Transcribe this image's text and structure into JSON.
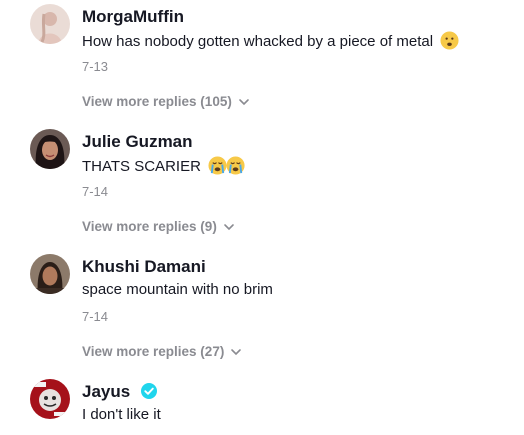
{
  "comments": [
    {
      "username": "MorgaMuffin",
      "text": "How has nobody gotten whacked by a piece of metal",
      "emoji": "frowning-face",
      "date": "7-13",
      "more_replies": "View more replies (105)",
      "avatar_color": "#e7cfc9"
    },
    {
      "username": "Julie Guzman",
      "text": "THATS SCARIER",
      "emoji": "crying-faces",
      "date": "7-14",
      "more_replies": "View more replies (9)",
      "avatar_color": "#2a1d1f"
    },
    {
      "username": "Khushi Damani",
      "text": "space mountain with no brim",
      "date": "7-14",
      "more_replies": "View more replies (27)",
      "avatar_color": "#4b3a30"
    },
    {
      "username": "Jayus",
      "verified": true,
      "text": "I don't like it",
      "avatar_color": "#b0121b"
    }
  ],
  "colors": {
    "primary_text": "#161823",
    "secondary_text": "#8a8b91",
    "verified_badge": "#20d5ec"
  }
}
